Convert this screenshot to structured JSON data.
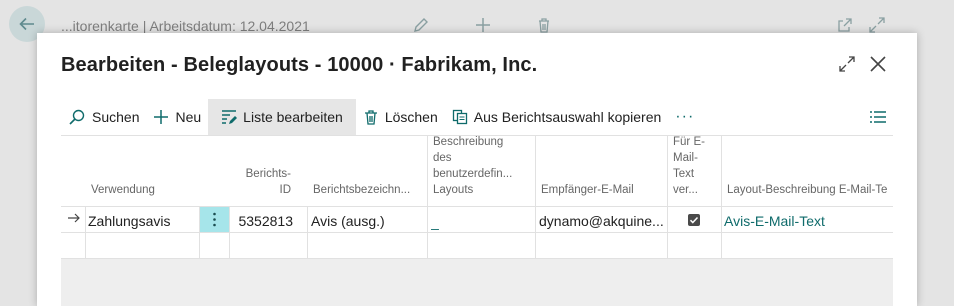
{
  "background": {
    "title": "...itorenkarte | Arbeitsdatum: 12.04.2021"
  },
  "dialog": {
    "title": "Bearbeiten - Beleglayouts - 10000 · Fabrikam, Inc."
  },
  "toolbar": {
    "search": "Suchen",
    "new": "Neu",
    "edit_list": "Liste bearbeiten",
    "delete": "Löschen",
    "copy_from_report_selection": "Aus Berichtsauswahl kopieren",
    "more": "···"
  },
  "table": {
    "headers": {
      "usage": "Verwendung",
      "report_id_1": "Berichts-",
      "report_id_2": "ID",
      "report_caption": "Berichtsbezeichn...",
      "custom_desc_1": "Beschreibung",
      "custom_desc_2": "des",
      "custom_desc_3": "benutzerdefin...",
      "custom_desc_4": "Layouts",
      "recipient_email": "Empfänger-E-Mail",
      "use_body_1": "Für E-",
      "use_body_2": "Mail-",
      "use_body_3": "Text",
      "use_body_4": "ver...",
      "layout_desc_email": "Layout-Beschreibung E-Mail-Te"
    },
    "rows": [
      {
        "usage": "Zahlungsavis",
        "report_id": "5352813",
        "report_caption": "Avis (ausg.)",
        "custom_desc": "_",
        "recipient_email": "dynamo@akquine...",
        "use_for_email_body": true,
        "layout_desc_email": "Avis-E-Mail-Text"
      }
    ]
  },
  "colors": {
    "accent": "#0f6b6b",
    "selection": "#a6e5ea"
  }
}
